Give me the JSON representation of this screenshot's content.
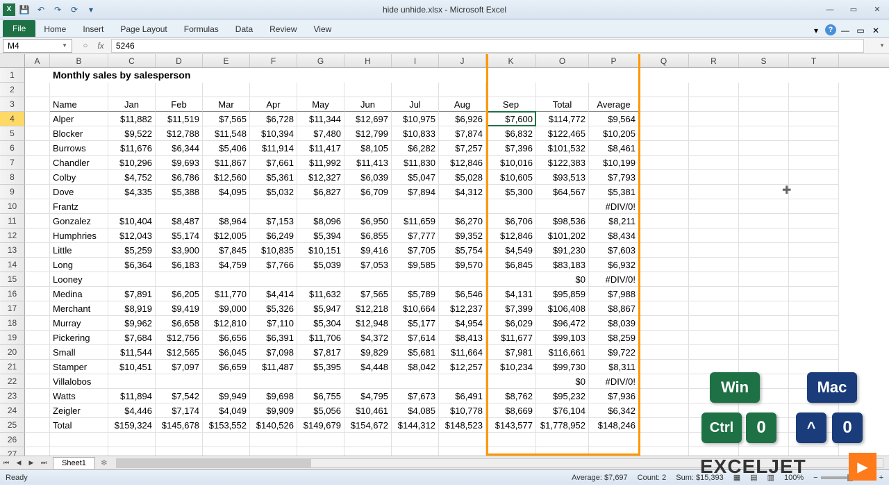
{
  "title": "hide unhide.xlsx - Microsoft Excel",
  "tabs": {
    "file": "File",
    "home": "Home",
    "insert": "Insert",
    "pageLayout": "Page Layout",
    "formulas": "Formulas",
    "data": "Data",
    "review": "Review",
    "view": "View"
  },
  "nameBox": "M4",
  "formulaBar": "5246",
  "colHeaders": [
    "A",
    "B",
    "C",
    "D",
    "E",
    "F",
    "G",
    "H",
    "I",
    "J",
    "K",
    "O",
    "P",
    "Q",
    "R",
    "S",
    "T"
  ],
  "rowNumbers": [
    "1",
    "2",
    "3",
    "4",
    "5",
    "6",
    "7",
    "8",
    "9",
    "10",
    "11",
    "12",
    "13",
    "14",
    "15",
    "16",
    "17",
    "18",
    "19",
    "20",
    "21",
    "22",
    "23",
    "24",
    "25",
    "26",
    "27"
  ],
  "activeRow": 4,
  "pageTitle": "Monthly sales by salesperson",
  "headers": [
    "Name",
    "Jan",
    "Feb",
    "Mar",
    "Apr",
    "May",
    "Jun",
    "Jul",
    "Aug",
    "Sep",
    "Total",
    "Average"
  ],
  "data": [
    [
      "Alper",
      "$11,882",
      "$11,519",
      "$7,565",
      "$6,728",
      "$11,344",
      "$12,697",
      "$10,975",
      "$6,926",
      "$7,600",
      "$114,772",
      "$9,564"
    ],
    [
      "Blocker",
      "$9,522",
      "$12,788",
      "$11,548",
      "$10,394",
      "$7,480",
      "$12,799",
      "$10,833",
      "$7,874",
      "$6,832",
      "$122,465",
      "$10,205"
    ],
    [
      "Burrows",
      "$11,676",
      "$6,344",
      "$5,406",
      "$11,914",
      "$11,417",
      "$8,105",
      "$6,282",
      "$7,257",
      "$7,396",
      "$101,532",
      "$8,461"
    ],
    [
      "Chandler",
      "$10,296",
      "$9,693",
      "$11,867",
      "$7,661",
      "$11,992",
      "$11,413",
      "$11,830",
      "$12,846",
      "$10,016",
      "$122,383",
      "$10,199"
    ],
    [
      "Colby",
      "$4,752",
      "$6,786",
      "$12,560",
      "$5,361",
      "$12,327",
      "$6,039",
      "$5,047",
      "$5,028",
      "$10,605",
      "$93,513",
      "$7,793"
    ],
    [
      "Dove",
      "$4,335",
      "$5,388",
      "$4,095",
      "$5,032",
      "$6,827",
      "$6,709",
      "$7,894",
      "$4,312",
      "$5,300",
      "$64,567",
      "$5,381"
    ],
    [
      "Frantz",
      "",
      "",
      "",
      "",
      "",
      "",
      "",
      "",
      "",
      "",
      "#DIV/0!"
    ],
    [
      "Gonzalez",
      "$10,404",
      "$8,487",
      "$8,964",
      "$7,153",
      "$8,096",
      "$6,950",
      "$11,659",
      "$6,270",
      "$6,706",
      "$98,536",
      "$8,211"
    ],
    [
      "Humphries",
      "$12,043",
      "$5,174",
      "$12,005",
      "$6,249",
      "$5,394",
      "$6,855",
      "$7,777",
      "$9,352",
      "$12,846",
      "$101,202",
      "$8,434"
    ],
    [
      "Little",
      "$5,259",
      "$3,900",
      "$7,845",
      "$10,835",
      "$10,151",
      "$9,416",
      "$7,705",
      "$5,754",
      "$4,549",
      "$91,230",
      "$7,603"
    ],
    [
      "Long",
      "$6,364",
      "$6,183",
      "$4,759",
      "$7,766",
      "$5,039",
      "$7,053",
      "$9,585",
      "$9,570",
      "$6,845",
      "$83,183",
      "$6,932"
    ],
    [
      "Looney",
      "",
      "",
      "",
      "",
      "",
      "",
      "",
      "",
      "",
      "$0",
      "#DIV/0!"
    ],
    [
      "Medina",
      "$7,891",
      "$6,205",
      "$11,770",
      "$4,414",
      "$11,632",
      "$7,565",
      "$5,789",
      "$6,546",
      "$4,131",
      "$95,859",
      "$7,988"
    ],
    [
      "Merchant",
      "$8,919",
      "$9,419",
      "$9,000",
      "$5,326",
      "$5,947",
      "$12,218",
      "$10,664",
      "$12,237",
      "$7,399",
      "$106,408",
      "$8,867"
    ],
    [
      "Murray",
      "$9,962",
      "$6,658",
      "$12,810",
      "$7,110",
      "$5,304",
      "$12,948",
      "$5,177",
      "$4,954",
      "$6,029",
      "$96,472",
      "$8,039"
    ],
    [
      "Pickering",
      "$7,684",
      "$12,756",
      "$6,656",
      "$6,391",
      "$11,706",
      "$4,372",
      "$7,614",
      "$8,413",
      "$11,677",
      "$99,103",
      "$8,259"
    ],
    [
      "Small",
      "$11,544",
      "$12,565",
      "$6,045",
      "$7,098",
      "$7,817",
      "$9,829",
      "$5,681",
      "$11,664",
      "$7,981",
      "$116,661",
      "$9,722"
    ],
    [
      "Stamper",
      "$10,451",
      "$7,097",
      "$6,659",
      "$11,487",
      "$5,395",
      "$4,448",
      "$8,042",
      "$12,257",
      "$10,234",
      "$99,730",
      "$8,311"
    ],
    [
      "Villalobos",
      "",
      "",
      "",
      "",
      "",
      "",
      "",
      "",
      "",
      "$0",
      "#DIV/0!"
    ],
    [
      "Watts",
      "$11,894",
      "$7,542",
      "$9,949",
      "$9,698",
      "$6,755",
      "$4,795",
      "$7,673",
      "$6,491",
      "$8,762",
      "$95,232",
      "$7,936"
    ],
    [
      "Zeigler",
      "$4,446",
      "$7,174",
      "$4,049",
      "$9,909",
      "$5,056",
      "$10,461",
      "$4,085",
      "$10,778",
      "$8,669",
      "$76,104",
      "$6,342"
    ],
    [
      "Total",
      "$159,324",
      "$145,678",
      "$153,552",
      "$140,526",
      "$149,679",
      "$154,672",
      "$144,312",
      "$148,523",
      "$143,577",
      "$1,778,952",
      "$148,246"
    ]
  ],
  "sheet": "Sheet1",
  "status": {
    "ready": "Ready",
    "avg": "Average: $7,697",
    "count": "Count: 2",
    "sum": "Sum: $15,393",
    "zoom": "100%"
  },
  "shortcuts": {
    "win": "Win",
    "mac": "Mac",
    "ctrl": "Ctrl",
    "zero1": "0",
    "caret": "^",
    "zero2": "0"
  },
  "brand": "EXCELJET"
}
